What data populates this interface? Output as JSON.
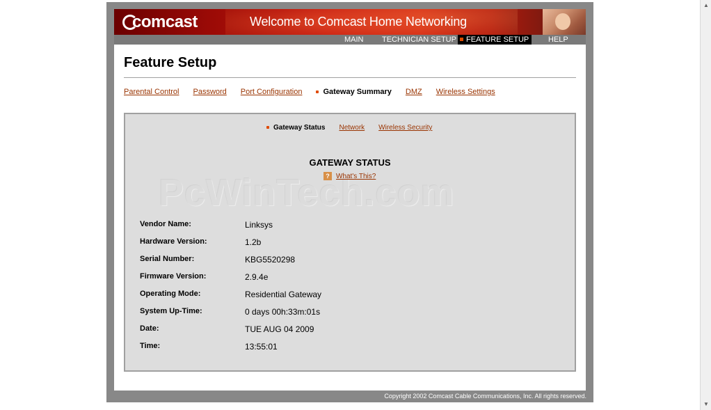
{
  "header": {
    "logo_text": "comcast",
    "banner_title": "Welcome to Comcast Home Networking"
  },
  "top_nav": [
    {
      "label": "MAIN",
      "active": false
    },
    {
      "label": "TECHNICIAN SETUP",
      "active": false
    },
    {
      "label": "FEATURE SETUP",
      "active": true
    },
    {
      "label": "HELP",
      "active": false
    }
  ],
  "page": {
    "title": "Feature Setup"
  },
  "sub_nav": [
    {
      "label": "Parental Control",
      "active": false
    },
    {
      "label": "Password",
      "active": false
    },
    {
      "label": "Port Configuration",
      "active": false
    },
    {
      "label": "Gateway Summary",
      "active": true
    },
    {
      "label": "DMZ",
      "active": false
    },
    {
      "label": "Wireless Settings",
      "active": false
    }
  ],
  "summary_tabs": [
    {
      "label": "Gateway Status",
      "active": true
    },
    {
      "label": "Network",
      "active": false
    },
    {
      "label": "Wireless Security",
      "active": false
    }
  ],
  "status": {
    "watermark": "PcWinTech.com",
    "title": "GATEWAY STATUS",
    "help_icon": "question-icon",
    "help_link": "What's This?",
    "rows": [
      {
        "label": "Vendor Name:",
        "value": "Linksys"
      },
      {
        "label": "Hardware Version:",
        "value": "1.2b"
      },
      {
        "label": "Serial Number:",
        "value": "KBG5520298"
      },
      {
        "label": "Firmware Version:",
        "value": "2.9.4e"
      },
      {
        "label": "Operating Mode:",
        "value": "Residential Gateway"
      },
      {
        "label": "System Up-Time:",
        "value": "0 days 00h:33m:01s"
      },
      {
        "label": "Date:",
        "value": "TUE AUG 04 2009"
      },
      {
        "label": "Time:",
        "value": "13:55:01"
      }
    ]
  },
  "footer": {
    "copyright": "Copyright 2002 Comcast Cable Communications, Inc. All rights reserved."
  },
  "colors": {
    "link": "#993300",
    "accent": "#e04a00",
    "banner_red": "#c3150d",
    "frame_grey": "#888888",
    "box_grey": "#dddddd"
  }
}
